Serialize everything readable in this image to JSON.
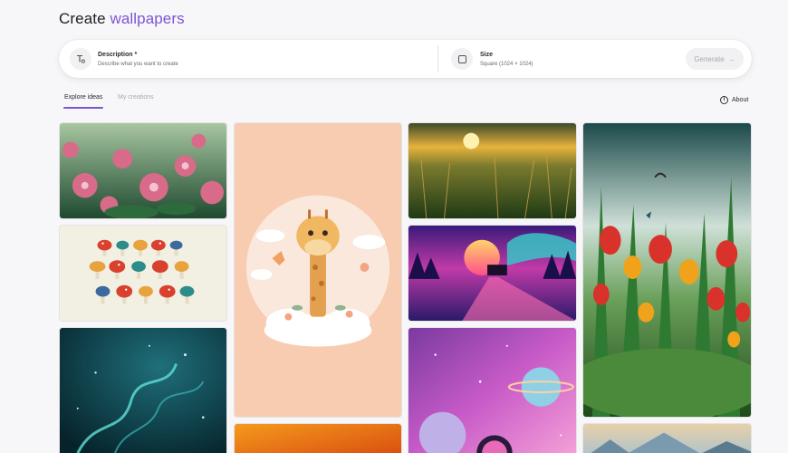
{
  "header": {
    "title_prefix": "Create",
    "title_accent": "wallpapers"
  },
  "prompt": {
    "description_label": "Description *",
    "description_hint": "Describe what you want to create",
    "size_label": "Size",
    "size_value": "Square (1024 × 1024)",
    "generate_label": "Generate"
  },
  "tabs": {
    "explore": "Explore ideas",
    "mine": "My creations"
  },
  "about_label": "About",
  "gallery": [
    {
      "name": "flower-garden-tile"
    },
    {
      "name": "mushrooms-tile"
    },
    {
      "name": "teal-abstract-tile"
    },
    {
      "name": "giraffe-tile"
    },
    {
      "name": "orange-gradient-tile"
    },
    {
      "name": "meadow-sunset-tile"
    },
    {
      "name": "synthwave-train-tile"
    },
    {
      "name": "space-planets-tile"
    },
    {
      "name": "tulips-tile"
    },
    {
      "name": "mountains-tile"
    }
  ],
  "colors": {
    "accent": "#7c54d6",
    "background": "#f7f7f9"
  }
}
